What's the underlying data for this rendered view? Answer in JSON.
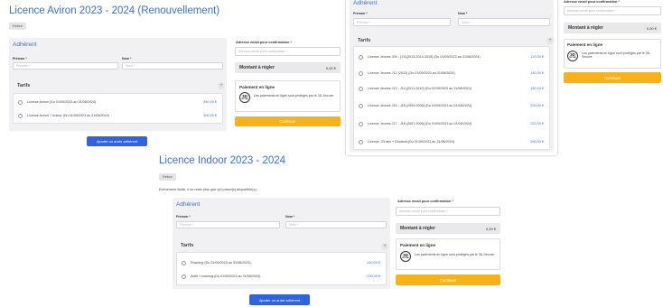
{
  "p1": {
    "title": "Licence Aviron 2023 - 2024 (Renouvellement)",
    "retour": "Retour",
    "adherent": "Adhérent",
    "prenom_label": "Prénom *",
    "prenom_placeholder": "Prénom *",
    "nom_label": "Nom *",
    "nom_placeholder": "Nom *",
    "tarifs": "Tarifs",
    "plus": "+",
    "items": [
      {
        "label": "Licence Aviron (Du 01/09/2023 au 31/08/2024)",
        "price": "350,00 €"
      },
      {
        "label": "Licence Aviron + Indoor (Du 01/09/2023 au 31/08/2024)",
        "price": "400,00 €"
      }
    ],
    "email_label": "Adresse email pour confirmation *",
    "email_placeholder": "Adresse email pour confirmation *",
    "montant_label": "Montant à régler",
    "montant_value": "0,00 €",
    "paiement_title": "Paiement en ligne",
    "paiement_text": "Les paiements en ligne sont protégés par le 3D-Secure.",
    "badge_top": "3D",
    "badge_bottom": "SECURE",
    "continuer": "Continuer",
    "ajouter": "Ajouter un autre adhérent"
  },
  "p2": {
    "adherent": "Adhérent",
    "prenom_label": "Prénom *",
    "prenom_placeholder": "Prénom *",
    "nom_label": "Nom *",
    "nom_placeholder": "Nom *",
    "tarifs": "Tarifs",
    "plus": "+",
    "items": [
      {
        "label": "Licence Jeunes J09 - (J11(2013-2014-2015) (Du 01/09/2023 au 31/08/2024)",
        "price": "120,00 €"
      },
      {
        "label": "Licence Jeunes J12 (2012) (Du 01/09/2023 au 31/08/2024)",
        "price": "140,00 €"
      },
      {
        "label": "Licence Jeunes J13 - J14 (2011-2010) (Du 01/09/2023 au 31/08/2024)",
        "price": "180,00 €"
      },
      {
        "label": "Licence Jeunes J15 - J16 (2009-2008) (Du 01/09/2023 au 31/08/2024)",
        "price": "200,00 €"
      },
      {
        "label": "Licence Jeunes J17 - J18 (2007-2006) (Du 01/09/2023 au 31/08/2024)",
        "price": "220,00 €"
      },
      {
        "label": "Licence -23 ans + Etudiant (Du 01/09/2023 au 31/08/2024)",
        "price": "250,00 €"
      }
    ]
  },
  "p3": {
    "email_label": "Adresse email pour confirmation *",
    "email_placeholder": "Adresse email pour confirmation *",
    "montant_label": "Montant à régler",
    "montant_value": "0,00 €",
    "paiement_title": "Paiement en ligne",
    "paiement_text": "Les paiements en ligne sont protégés par le 3D-Secure.",
    "badge_top": "3D",
    "badge_bottom": "SECURE",
    "continuer": "Continuer"
  },
  "p4": {
    "title": "Licence Indoor 2023 - 2024",
    "retour": "Retour",
    "notice": "Evènement limité, il ne reste plus que x(x) place(s) disponible(s).",
    "adherent": "Adhérent",
    "prenom_label": "Prénom *",
    "prenom_placeholder": "Prénom *",
    "nom_label": "Nom *",
    "nom_placeholder": "Nom *",
    "tarifs": "Tarifs",
    "plus": "+",
    "items": [
      {
        "label": "Rowning (Du 01/09/2023 au 31/08/2024)",
        "price": "140,00 €"
      },
      {
        "label": "Avifit + rowning (Du 01/09/2023 au 31/08/2024)",
        "price": "230,00 €"
      }
    ],
    "email_label": "Adresse email pour confirmation *",
    "email_placeholder": "Adresse email pour confirmation *",
    "montant_label": "Montant à régler",
    "montant_value": "0,00 €",
    "paiement_title": "Paiement en ligne",
    "paiement_text": "Les paiements en ligne sont protégés par le 3D-Secure.",
    "badge_top": "3D",
    "badge_bottom": "SECURE",
    "continuer": "Continuer",
    "ajouter": "Ajouter un autre adhérent"
  }
}
